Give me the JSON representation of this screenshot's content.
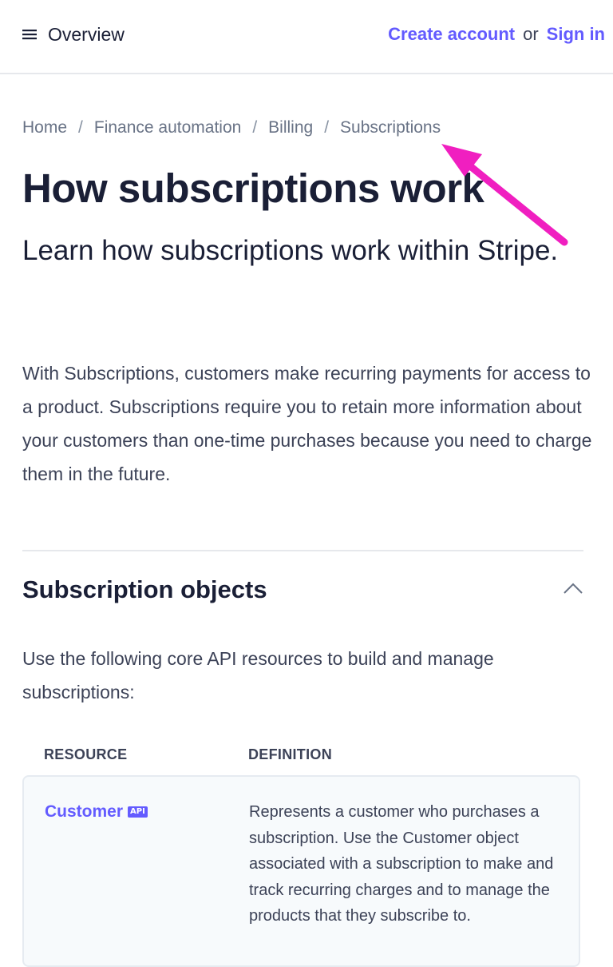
{
  "topbar": {
    "menu_label": "Overview",
    "create_account": "Create account",
    "or": "or",
    "sign_in": "Sign in"
  },
  "breadcrumb": {
    "items": [
      "Home",
      "Finance automation",
      "Billing",
      "Subscriptions"
    ],
    "separator": "/"
  },
  "page": {
    "title": "How subscriptions work",
    "subtitle": "Learn how subscriptions work within Stripe.",
    "intro": "With Subscriptions, customers make recurring payments for access to a product. Subscriptions require you to retain more information about your customers than one-time purchases because you need to charge them in the future."
  },
  "section": {
    "title": "Subscription objects",
    "description": "Use the following core API resources to build and manage subscriptions:",
    "collapse_icon": "chevron-up-icon"
  },
  "table": {
    "headers": [
      "RESOURCE",
      "DEFINITION"
    ],
    "rows": [
      {
        "resource": "Customer",
        "badge": "API",
        "definition": "Represents a customer who purchases a subscription. Use the Customer object associated with a subscription to make and track recurring charges and to manage the products that they subscribe to."
      }
    ]
  },
  "colors": {
    "accent": "#635bff",
    "annotation_arrow": "#f01fc0",
    "text_primary": "#1a1f36",
    "text_secondary": "#3c4257"
  }
}
